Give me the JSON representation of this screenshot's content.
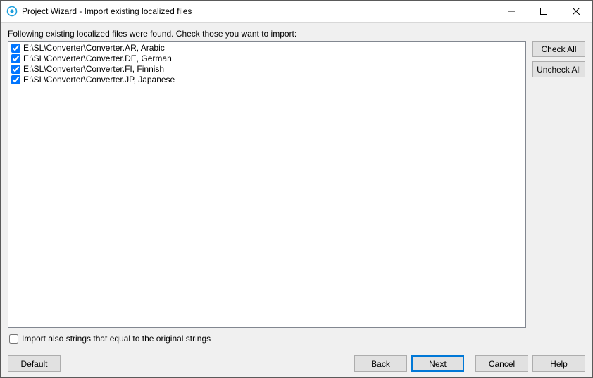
{
  "window": {
    "title": "Project Wizard - Import existing localized files"
  },
  "instruction": "Following existing localized files were found. Check those you want to import:",
  "files": [
    {
      "checked": true,
      "path": "E:\\SL\\Converter\\Converter.AR, Arabic"
    },
    {
      "checked": true,
      "path": "E:\\SL\\Converter\\Converter.DE, German"
    },
    {
      "checked": true,
      "path": "E:\\SL\\Converter\\Converter.FI, Finnish"
    },
    {
      "checked": true,
      "path": "E:\\SL\\Converter\\Converter.JP, Japanese"
    }
  ],
  "side": {
    "check_all": "Check All",
    "uncheck_all": "Uncheck All"
  },
  "import_equal": {
    "checked": false,
    "label": "Import also strings that equal to the original strings"
  },
  "buttons": {
    "default": "Default",
    "back": "Back",
    "next": "Next",
    "cancel": "Cancel",
    "help": "Help"
  }
}
